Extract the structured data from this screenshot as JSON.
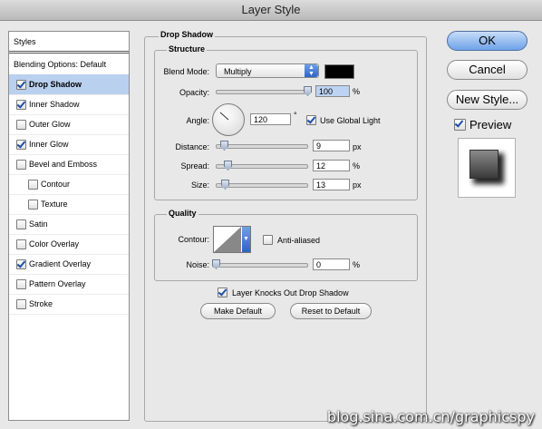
{
  "window": {
    "title": "Layer Style"
  },
  "styles_list": {
    "header": "Styles",
    "blending": "Blending Options: Default",
    "items": [
      {
        "label": "Drop Shadow",
        "checked": true,
        "selected": true,
        "indent": false
      },
      {
        "label": "Inner Shadow",
        "checked": true,
        "selected": false,
        "indent": false
      },
      {
        "label": "Outer Glow",
        "checked": false,
        "selected": false,
        "indent": false
      },
      {
        "label": "Inner Glow",
        "checked": true,
        "selected": false,
        "indent": false
      },
      {
        "label": "Bevel and Emboss",
        "checked": false,
        "selected": false,
        "indent": false
      },
      {
        "label": "Contour",
        "checked": false,
        "selected": false,
        "indent": true
      },
      {
        "label": "Texture",
        "checked": false,
        "selected": false,
        "indent": true
      },
      {
        "label": "Satin",
        "checked": false,
        "selected": false,
        "indent": false
      },
      {
        "label": "Color Overlay",
        "checked": false,
        "selected": false,
        "indent": false
      },
      {
        "label": "Gradient Overlay",
        "checked": true,
        "selected": false,
        "indent": false
      },
      {
        "label": "Pattern Overlay",
        "checked": false,
        "selected": false,
        "indent": false
      },
      {
        "label": "Stroke",
        "checked": false,
        "selected": false,
        "indent": false
      }
    ]
  },
  "drop_shadow": {
    "title": "Drop Shadow",
    "structure": {
      "title": "Structure",
      "blend_mode_label": "Blend Mode:",
      "blend_mode_value": "Multiply",
      "shadow_color": "#000000",
      "opacity_label": "Opacity:",
      "opacity_value": "100",
      "opacity_unit": "%",
      "angle_label": "Angle:",
      "angle_value": "120",
      "angle_unit": "°",
      "use_global_light_label": "Use Global Light",
      "use_global_light": true,
      "distance_label": "Distance:",
      "distance_value": "9",
      "distance_unit": "px",
      "spread_label": "Spread:",
      "spread_value": "12",
      "spread_unit": "%",
      "size_label": "Size:",
      "size_value": "13",
      "size_unit": "px"
    },
    "quality": {
      "title": "Quality",
      "contour_label": "Contour:",
      "anti_aliased_label": "Anti-aliased",
      "anti_aliased": false,
      "noise_label": "Noise:",
      "noise_value": "0",
      "noise_unit": "%"
    },
    "knockout_label": "Layer Knocks Out Drop Shadow",
    "knockout": true,
    "make_default_label": "Make Default",
    "reset_default_label": "Reset to Default"
  },
  "buttons": {
    "ok": "OK",
    "cancel": "Cancel",
    "new_style": "New Style...",
    "preview_label": "Preview",
    "preview_checked": true
  },
  "watermark": "blog.sina.com.cn/graphicspy"
}
